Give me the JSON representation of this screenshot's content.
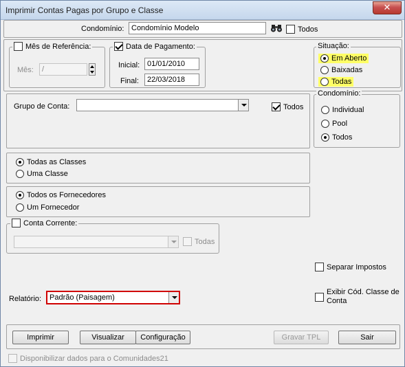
{
  "window": {
    "title": "Imprimir Contas Pagas por Grupo e Classe",
    "close_symbol": "✕"
  },
  "condominio": {
    "label": "Condomínio:",
    "value": "Condomínio Modelo",
    "search_icon": "binoculars-icon",
    "todos_label": "Todos"
  },
  "mes_referencia": {
    "checkbox_label": "Mês de Referência:",
    "mes_label": "Mês:",
    "mes_value": "/"
  },
  "data_pagamento": {
    "checkbox_label": "Data de Pagamento:",
    "inicial_label": "Inicial:",
    "inicial_value": "01/01/2010",
    "final_label": "Final:",
    "final_value": "22/03/2018"
  },
  "situacao": {
    "legend": "Situação:",
    "options": [
      "Em Aberto",
      "Baixadas",
      "Todas"
    ],
    "selected": "Em Aberto"
  },
  "grupo_conta": {
    "label": "Grupo de Conta:",
    "value": "",
    "todos_label": "Todos"
  },
  "condominio_tipo": {
    "legend": "Condomínio:",
    "options": [
      "Individual",
      "Pool",
      "Todos"
    ],
    "selected": "Todos"
  },
  "classes": {
    "options": [
      "Todas as Classes",
      "Uma Classe"
    ],
    "selected": "Todas as Classes"
  },
  "fornecedores": {
    "options": [
      "Todos os Fornecedores",
      "Um Fornecedor"
    ],
    "selected": "Todos os Fornecedores"
  },
  "conta_corrente": {
    "checkbox_label": "Conta Corrente:",
    "value": "",
    "todas_label": "Todas"
  },
  "options": {
    "separar_impostos": "Separar Impostos",
    "exibir_cod_line1": "Exibir Cód. Classe de",
    "exibir_cod_line2": "Conta"
  },
  "relatorio": {
    "label": "Relatório:",
    "value": "Padrão (Paisagem)"
  },
  "buttons": {
    "imprimir": "Imprimir",
    "visualizar": "Visualizar",
    "configuracao": "Configuração",
    "gravar_tpl": "Gravar TPL",
    "sair": "Sair"
  },
  "footer": {
    "comunidades_label": "Disponibilizar dados para o Comunidades21"
  },
  "colors": {
    "highlight": "#ffff66",
    "relatorio_border": "#d00000",
    "titlebar": "#c5d7ec"
  }
}
